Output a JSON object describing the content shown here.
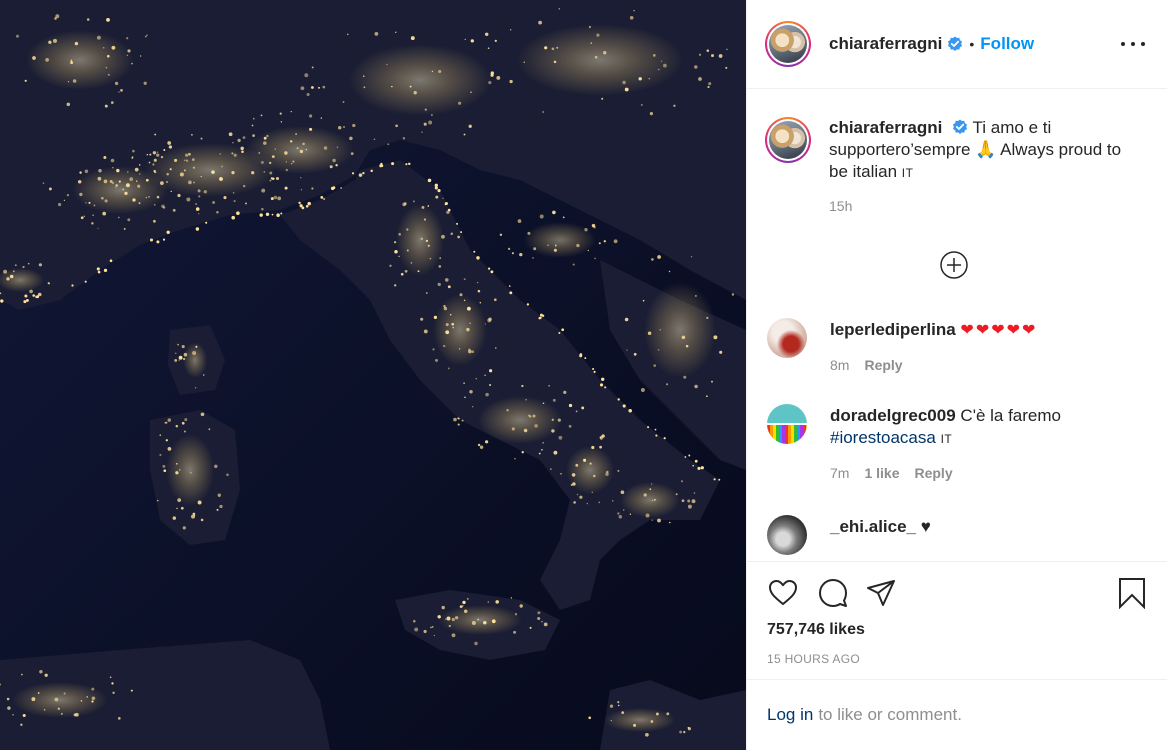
{
  "post": {
    "author": "chiaraferragni",
    "follow_label": "Follow",
    "separator": "•",
    "caption_text": "Ti amo e ti supportero’sempre 🙏 Always proud to be italian",
    "caption_lang": "IT",
    "caption_time": "15h",
    "likes": "757,746 likes",
    "posted_ago": "15 HOURS AGO"
  },
  "comments": [
    {
      "user": "leperlediperlina",
      "text": "❤❤❤❤❤",
      "time": "8m",
      "likes": "",
      "reply": "Reply"
    },
    {
      "user": "doradelgrec009",
      "text": "C'è la faremo",
      "hashtag": "#iorestoacasa",
      "lang": "IT",
      "time": "7m",
      "likes": "1 like",
      "reply": "Reply"
    },
    {
      "user": "_ehi.alice_",
      "text": "♥"
    }
  ],
  "login": {
    "link": "Log in",
    "text": "to like or comment."
  },
  "icons": [
    "verified-badge-icon",
    "more-options-icon",
    "load-more-comments-icon",
    "heart-icon",
    "comment-icon",
    "share-icon",
    "bookmark-icon"
  ],
  "colors": {
    "accent": "#0095f6",
    "link": "#00376b",
    "muted": "#8e8e8e",
    "night_sea": "#0a0d24",
    "city_lights": "#f7d37a"
  }
}
